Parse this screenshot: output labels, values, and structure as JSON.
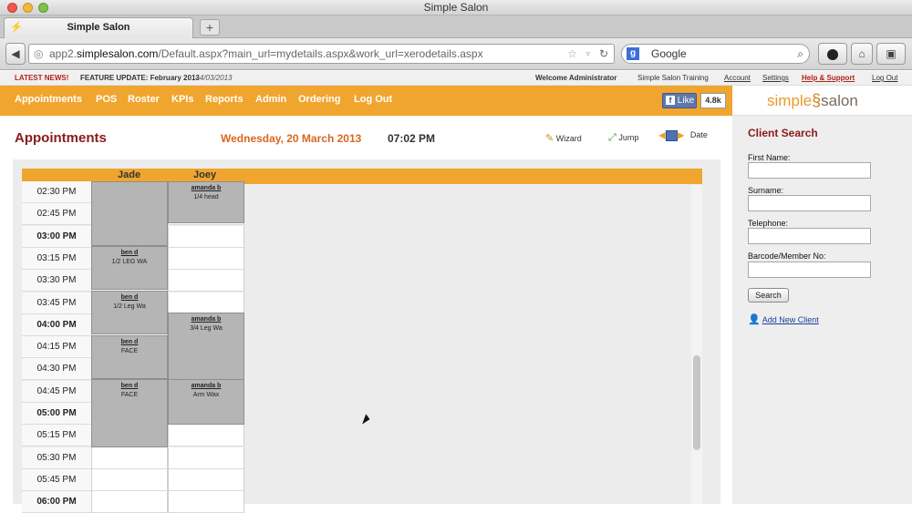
{
  "browser": {
    "window_title": "Simple Salon",
    "tab_title": "Simple Salon",
    "new_tab_label": "+",
    "url_prefix": "app2.",
    "url_domain": "simplesalon.com",
    "url_path": "/Default.aspx?main_url=mydetails.aspx&work_url=xerodetails.aspx",
    "search_placeholder": "Google"
  },
  "newsbar": {
    "label": "LATEST NEWS!",
    "headline": "FEATURE UPDATE: February 2013",
    "date": "- 4/03/2013",
    "welcome": "Welcome Administrator",
    "training": "Simple Salon Training",
    "links": [
      "Account",
      "Settings",
      "Help & Support",
      "Log Out"
    ]
  },
  "nav": {
    "items": [
      "Appointments",
      "POS",
      "Roster",
      "KPIs",
      "Reports",
      "Admin",
      "Ordering",
      "Log Out"
    ],
    "like_label": "Like",
    "like_count": "4.8k"
  },
  "logo": {
    "part1": "simple",
    "part2": "salon"
  },
  "header": {
    "title": "Appointments",
    "date": "Wednesday, 20 March 2013",
    "time": "07:02 PM",
    "wizard_label": "Wizard",
    "jump_label": "Jump",
    "date_label": "Date"
  },
  "grid": {
    "staff": [
      "Jade",
      "Joey"
    ],
    "times": [
      "02:30 PM",
      "02:45 PM",
      "03:00 PM",
      "03:15 PM",
      "03:30 PM",
      "03:45 PM",
      "04:00 PM",
      "04:15 PM",
      "04:30 PM",
      "04:45 PM",
      "05:00 PM",
      "05:15 PM",
      "05:30 PM",
      "05:45 PM",
      "06:00 PM"
    ],
    "bold_times": [
      "03:00 PM",
      "04:00 PM",
      "05:00 PM",
      "06:00 PM"
    ],
    "appointments": [
      {
        "staff": "Joey",
        "client": "amanda b",
        "service": "1/4 head"
      },
      {
        "staff": "Jade",
        "client": "ben d",
        "service": "1/2 LEG WA"
      },
      {
        "staff": "Jade",
        "client": "ben d",
        "service": "1/2 Leg Wa"
      },
      {
        "staff": "Joey",
        "client": "amanda b",
        "service": "3/4 Leg Wa"
      },
      {
        "staff": "Jade",
        "client": "ben d",
        "service": "FACE"
      },
      {
        "staff": "Jade",
        "client": "ben d",
        "service": "FACE"
      },
      {
        "staff": "Joey",
        "client": "amanda b",
        "service": "Arm Wax"
      }
    ]
  },
  "client_search": {
    "title": "Client Search",
    "first_name_label": "First Name:",
    "surname_label": "Surname:",
    "telephone_label": "Telephone:",
    "barcode_label": "Barcode/Member No:",
    "search_button": "Search",
    "add_new_client": "Add New Client"
  },
  "colors": {
    "accent_orange": "#f0a52e",
    "title_red": "#8b1a1a",
    "date_orange": "#d9661f",
    "appointment_gray": "#b5b5b5"
  }
}
